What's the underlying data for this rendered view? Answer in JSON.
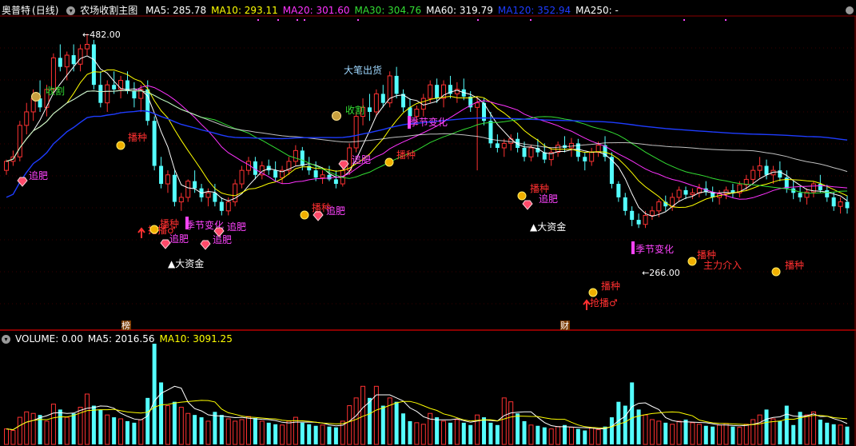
{
  "header": {
    "stock": "奥普特",
    "period": "(日线)",
    "indicator": "农场收割主图",
    "ma_items": [
      {
        "label": "MA5: 285.78",
        "color": "#ffffff"
      },
      {
        "label": "MA10: 293.11",
        "color": "#ffff00"
      },
      {
        "label": "MA20: 301.60",
        "color": "#ff33ff"
      },
      {
        "label": "MA30: 304.76",
        "color": "#33dd33"
      },
      {
        "label": "MA60: 319.79",
        "color": "#ffffff"
      },
      {
        "label": "MA120: 352.94",
        "color": "#1e3cff"
      },
      {
        "label": "MA250: -",
        "color": "#ffffff"
      }
    ]
  },
  "volume_header": {
    "items": [
      {
        "label": "VOLUME: 0.00",
        "color": "#ffffff"
      },
      {
        "label": "MA5: 2016.56",
        "color": "#ffffff"
      },
      {
        "label": "MA10: 3091.25",
        "color": "#ffff00"
      }
    ]
  },
  "annotations": {
    "high_label": "482.00",
    "low_label": "266.00",
    "markers": [
      {
        "text": "收割",
        "color": "#33dd33"
      },
      {
        "text": "追肥",
        "color": "#ff44ff"
      },
      {
        "text": "播种",
        "color": "#ff3030"
      },
      {
        "text": "播种",
        "color": "#ff3030"
      },
      {
        "text": "抢播♂",
        "color": "#ff3030"
      },
      {
        "text": "季节变化",
        "color": "#ff44ff"
      },
      {
        "text": "追肥",
        "color": "#ff44ff"
      },
      {
        "text": "追肥",
        "color": "#ff44ff"
      },
      {
        "text": "追肥",
        "color": "#ff44ff"
      },
      {
        "text": "▲大资金",
        "color": "#ffffff"
      },
      {
        "text": "大笔出货",
        "color": "#9fd8ff"
      },
      {
        "text": "收割",
        "color": "#33dd33"
      },
      {
        "text": "季节变化",
        "color": "#ff44ff"
      },
      {
        "text": "追肥",
        "color": "#ff44ff"
      },
      {
        "text": "播种",
        "color": "#ff3030"
      },
      {
        "text": "播种",
        "color": "#ff3030"
      },
      {
        "text": "追肥",
        "color": "#ff44ff"
      },
      {
        "text": "播种",
        "color": "#ff3030"
      },
      {
        "text": "追肥",
        "color": "#ff44ff"
      },
      {
        "text": "▲大资金",
        "color": "#ffffff"
      },
      {
        "text": "播种",
        "color": "#ff3030"
      },
      {
        "text": "抢播♂",
        "color": "#ff3030"
      },
      {
        "text": "季节变化",
        "color": "#ff44ff"
      },
      {
        "text": "播种",
        "color": "#ff3030"
      },
      {
        "text": "主力介入",
        "color": "#ff3030"
      },
      {
        "text": "播种",
        "color": "#ff3030"
      }
    ],
    "badges": [
      "榜",
      "财"
    ]
  },
  "chart_data": {
    "type": "candlestick",
    "price_range": [
      228,
      482
    ],
    "high": 482.0,
    "low": 266.0,
    "bars": [
      [
        330,
        342,
        325,
        340
      ],
      [
        340,
        352,
        335,
        345
      ],
      [
        345,
        385,
        340,
        380
      ],
      [
        380,
        405,
        370,
        395
      ],
      [
        395,
        420,
        385,
        410
      ],
      [
        410,
        430,
        395,
        400
      ],
      [
        400,
        425,
        390,
        420
      ],
      [
        420,
        460,
        415,
        455
      ],
      [
        455,
        470,
        440,
        445
      ],
      [
        445,
        462,
        430,
        458
      ],
      [
        458,
        470,
        440,
        448
      ],
      [
        448,
        470,
        440,
        465
      ],
      [
        465,
        482,
        458,
        470
      ],
      [
        470,
        475,
        420,
        425
      ],
      [
        425,
        440,
        400,
        405
      ],
      [
        405,
        430,
        395,
        425
      ],
      [
        425,
        440,
        415,
        420
      ],
      [
        420,
        435,
        410,
        430
      ],
      [
        430,
        440,
        415,
        418
      ],
      [
        418,
        428,
        400,
        410
      ],
      [
        410,
        425,
        395,
        420
      ],
      [
        420,
        430,
        380,
        385
      ],
      [
        385,
        390,
        330,
        335
      ],
      [
        335,
        345,
        310,
        315
      ],
      [
        315,
        330,
        305,
        325
      ],
      [
        325,
        330,
        290,
        295
      ],
      [
        295,
        305,
        285,
        300
      ],
      [
        300,
        320,
        295,
        318
      ],
      [
        318,
        330,
        305,
        310
      ],
      [
        310,
        315,
        295,
        300
      ],
      [
        300,
        310,
        290,
        305
      ],
      [
        305,
        315,
        290,
        295
      ],
      [
        295,
        300,
        280,
        285
      ],
      [
        285,
        300,
        280,
        295
      ],
      [
        295,
        320,
        290,
        315
      ],
      [
        315,
        335,
        310,
        330
      ],
      [
        330,
        345,
        325,
        340
      ],
      [
        340,
        345,
        320,
        325
      ],
      [
        325,
        340,
        320,
        335
      ],
      [
        335,
        342,
        325,
        330
      ],
      [
        330,
        340,
        318,
        322
      ],
      [
        322,
        335,
        315,
        330
      ],
      [
        330,
        345,
        325,
        340
      ],
      [
        340,
        358,
        335,
        352
      ],
      [
        352,
        356,
        330,
        335
      ],
      [
        335,
        345,
        325,
        330
      ],
      [
        330,
        340,
        318,
        322
      ],
      [
        322,
        330,
        315,
        325
      ],
      [
        325,
        335,
        318,
        320
      ],
      [
        320,
        330,
        310,
        315
      ],
      [
        315,
        335,
        312,
        330
      ],
      [
        330,
        360,
        325,
        355
      ],
      [
        355,
        395,
        350,
        390
      ],
      [
        390,
        410,
        380,
        400
      ],
      [
        400,
        415,
        385,
        395
      ],
      [
        395,
        420,
        390,
        415
      ],
      [
        415,
        425,
        400,
        405
      ],
      [
        405,
        440,
        400,
        435
      ],
      [
        435,
        445,
        410,
        415
      ],
      [
        415,
        420,
        395,
        400
      ],
      [
        400,
        410,
        385,
        390
      ],
      [
        390,
        402,
        380,
        398
      ],
      [
        398,
        415,
        390,
        410
      ],
      [
        410,
        430,
        405,
        425
      ],
      [
        425,
        432,
        405,
        410
      ],
      [
        410,
        430,
        400,
        425
      ],
      [
        425,
        435,
        410,
        415
      ],
      [
        415,
        428,
        405,
        420
      ],
      [
        420,
        432,
        408,
        412
      ],
      [
        412,
        418,
        395,
        400
      ],
      [
        400,
        412,
        330,
        405
      ],
      [
        405,
        410,
        380,
        385
      ],
      [
        385,
        395,
        355,
        360
      ],
      [
        360,
        370,
        350,
        355
      ],
      [
        355,
        365,
        345,
        360
      ],
      [
        360,
        370,
        352,
        365
      ],
      [
        365,
        372,
        350,
        355
      ],
      [
        355,
        362,
        340,
        345
      ],
      [
        345,
        358,
        340,
        355
      ],
      [
        355,
        365,
        345,
        350
      ],
      [
        350,
        360,
        338,
        342
      ],
      [
        342,
        355,
        335,
        350
      ],
      [
        350,
        362,
        345,
        358
      ],
      [
        358,
        368,
        350,
        355
      ],
      [
        355,
        366,
        345,
        360
      ],
      [
        360,
        365,
        340,
        345
      ],
      [
        345,
        350,
        330,
        340
      ],
      [
        340,
        355,
        335,
        350
      ],
      [
        350,
        362,
        345,
        358
      ],
      [
        358,
        368,
        340,
        345
      ],
      [
        345,
        350,
        310,
        315
      ],
      [
        315,
        318,
        295,
        300
      ],
      [
        300,
        305,
        280,
        285
      ],
      [
        285,
        290,
        268,
        275
      ],
      [
        275,
        282,
        266,
        270
      ],
      [
        270,
        285,
        266,
        280
      ],
      [
        280,
        290,
        275,
        285
      ],
      [
        285,
        298,
        278,
        295
      ],
      [
        295,
        302,
        285,
        290
      ],
      [
        290,
        305,
        285,
        300
      ],
      [
        300,
        312,
        295,
        308
      ],
      [
        308,
        312,
        298,
        303
      ],
      [
        303,
        310,
        298,
        305
      ],
      [
        305,
        315,
        300,
        310
      ],
      [
        310,
        318,
        302,
        306
      ],
      [
        306,
        312,
        295,
        300
      ],
      [
        300,
        308,
        292,
        304
      ],
      [
        304,
        312,
        298,
        308
      ],
      [
        308,
        315,
        300,
        305
      ],
      [
        305,
        318,
        300,
        314
      ],
      [
        314,
        325,
        308,
        320
      ],
      [
        320,
        335,
        315,
        330
      ],
      [
        330,
        345,
        322,
        335
      ],
      [
        335,
        342,
        320,
        325
      ],
      [
        325,
        335,
        315,
        330
      ],
      [
        330,
        340,
        318,
        322
      ],
      [
        322,
        330,
        305,
        310
      ],
      [
        310,
        318,
        298,
        305
      ],
      [
        305,
        312,
        295,
        300
      ],
      [
        300,
        310,
        292,
        306
      ],
      [
        306,
        318,
        300,
        315
      ],
      [
        315,
        325,
        305,
        308
      ],
      [
        308,
        314,
        295,
        300
      ],
      [
        300,
        306,
        285,
        290
      ],
      [
        290,
        300,
        282,
        295
      ],
      [
        295,
        302,
        282,
        288
      ]
    ],
    "volume_range": [
      0,
      13000
    ],
    "volumes": [
      2000,
      1800,
      3500,
      4200,
      4000,
      3800,
      3000,
      5200,
      4500,
      3500,
      4000,
      4800,
      6500,
      5000,
      4500,
      3800,
      3500,
      3300,
      3000,
      2800,
      3200,
      6000,
      13000,
      8000,
      5000,
      5500,
      4800,
      4000,
      3800,
      3500,
      3000,
      4200,
      3800,
      3300,
      3000,
      3200,
      3600,
      3400,
      3000,
      2800,
      2600,
      2500,
      3000,
      3500,
      2800,
      2600,
      2400,
      2500,
      2300,
      2200,
      3000,
      5000,
      6000,
      7500,
      6000,
      7500,
      5000,
      6000,
      5500,
      4000,
      3000,
      2800,
      2600,
      4000,
      3500,
      3000,
      2800,
      3200,
      2800,
      2500,
      3800,
      3500,
      2800,
      2500,
      6000,
      5500,
      4000,
      3000,
      2500,
      2400,
      2200,
      2000,
      2300,
      2500,
      2200,
      2000,
      1800,
      2100,
      1900,
      2300,
      3500,
      5500,
      5000,
      8000,
      4500,
      3800,
      3200,
      3000,
      2800,
      2600,
      3000,
      3200,
      2800,
      2600,
      2400,
      2300,
      2500,
      2700,
      2300,
      2200,
      2600,
      3200,
      3800,
      4500,
      3300,
      3000,
      5000,
      2500,
      4200,
      3800,
      4200,
      3200,
      2800,
      2600,
      2500,
      2300
    ],
    "ma_series": [
      "MA5",
      "MA10",
      "MA20",
      "MA30",
      "MA60",
      "MA120"
    ]
  },
  "colors": {
    "up": "#ff3232",
    "down": "#54ffff",
    "grid": "#8b0000"
  }
}
